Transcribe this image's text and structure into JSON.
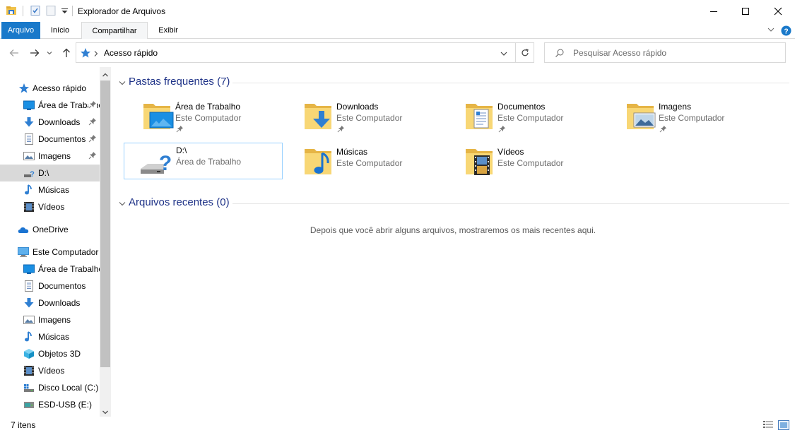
{
  "window": {
    "title": "Explorador de Arquivos",
    "controls": [
      "minimize",
      "maximize",
      "close"
    ]
  },
  "ribbon": {
    "tabs": [
      {
        "label": "Arquivo",
        "active": true
      },
      {
        "label": "Início"
      },
      {
        "label": "Compartilhar"
      },
      {
        "label": "Exibir"
      }
    ]
  },
  "address": {
    "path": "Acesso rápido",
    "search_placeholder": "Pesquisar Acesso rápido"
  },
  "sidebar": {
    "items": [
      {
        "label": "Acesso rápido",
        "icon": "star-icon",
        "level": 0
      },
      {
        "label": "Área de Trabalho",
        "icon": "desktop-icon",
        "pinned": true,
        "level": 1
      },
      {
        "label": "Downloads",
        "icon": "download-icon",
        "pinned": true,
        "level": 1
      },
      {
        "label": "Documentos",
        "icon": "document-icon",
        "pinned": true,
        "level": 1
      },
      {
        "label": "Imagens",
        "icon": "pictures-icon",
        "pinned": true,
        "level": 1
      },
      {
        "label": "D:\\",
        "icon": "unknown-drive-icon",
        "selected": true,
        "level": 1
      },
      {
        "label": "Músicas",
        "icon": "music-icon",
        "level": 1
      },
      {
        "label": "Vídeos",
        "icon": "video-icon",
        "level": 1
      },
      {
        "label": "OneDrive",
        "icon": "cloud-icon",
        "level": 0
      },
      {
        "label": "Este Computador",
        "icon": "computer-icon",
        "level": 0
      },
      {
        "label": "Área de Trabalho",
        "icon": "desktop-icon",
        "level": 1
      },
      {
        "label": "Documentos",
        "icon": "document-icon",
        "level": 1
      },
      {
        "label": "Downloads",
        "icon": "download-icon",
        "level": 1
      },
      {
        "label": "Imagens",
        "icon": "pictures-icon",
        "level": 1
      },
      {
        "label": "Músicas",
        "icon": "music-icon",
        "level": 1
      },
      {
        "label": "Objetos 3D",
        "icon": "cube-icon",
        "level": 1
      },
      {
        "label": "Vídeos",
        "icon": "video-icon",
        "level": 1
      },
      {
        "label": "Disco Local (C:)",
        "icon": "local-disk-icon",
        "level": 1
      },
      {
        "label": "ESD-USB (E:)",
        "icon": "usb-drive-icon",
        "level": 1
      }
    ]
  },
  "main": {
    "frequent": {
      "title": "Pastas frequentes (7)",
      "items": [
        {
          "name": "Área de Trabalho",
          "location": "Este Computador",
          "icon": "desktop-folder-icon",
          "pinned": true
        },
        {
          "name": "Downloads",
          "location": "Este Computador",
          "icon": "downloads-folder-icon",
          "pinned": true
        },
        {
          "name": "Documentos",
          "location": "Este Computador",
          "icon": "documents-folder-icon",
          "pinned": true
        },
        {
          "name": "Imagens",
          "location": "Este Computador",
          "icon": "pictures-folder-icon",
          "pinned": true
        },
        {
          "name": "D:\\",
          "location": "Área de Trabalho",
          "icon": "unknown-drive-icon",
          "selected": true
        },
        {
          "name": "Músicas",
          "location": "Este Computador",
          "icon": "music-folder-icon"
        },
        {
          "name": "Vídeos",
          "location": "Este Computador",
          "icon": "videos-folder-icon"
        }
      ]
    },
    "recent": {
      "title": "Arquivos recentes (0)",
      "empty_message": "Depois que você abrir alguns arquivos, mostraremos os mais recentes aqui."
    }
  },
  "status": {
    "item_count": "7 itens"
  },
  "colors": {
    "accent": "#1979ca",
    "group_header": "#1e3287",
    "selection": "#d9d9d9",
    "folder": "#f8d775"
  }
}
